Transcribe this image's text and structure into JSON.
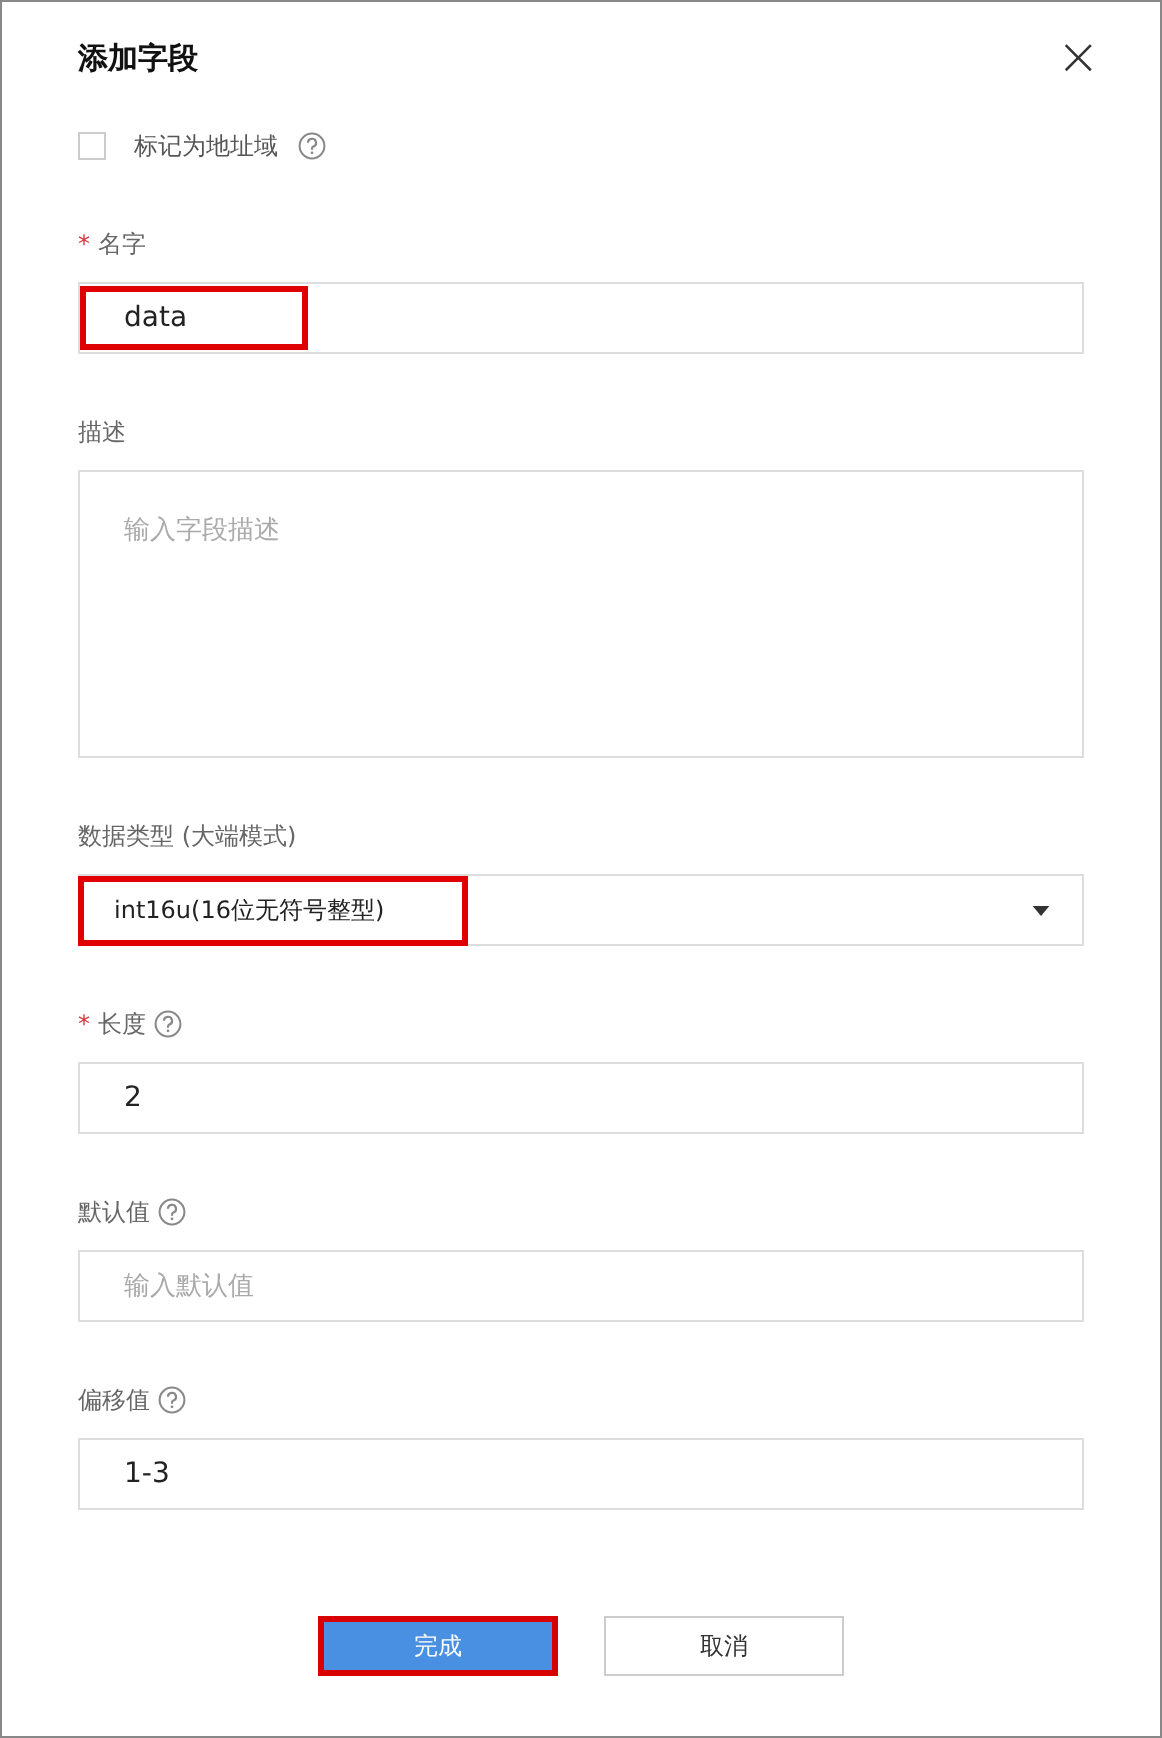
{
  "dialog": {
    "title": "添加字段",
    "close_icon": "×"
  },
  "address_checkbox": {
    "label": "标记为地址域",
    "checked": false,
    "help": true
  },
  "fields": [
    {
      "kind": "text",
      "required_mark": "*",
      "label": "名字",
      "value": "data",
      "highlighted": true
    },
    {
      "kind": "textarea",
      "label": "描述",
      "placeholder": "输入字段描述"
    },
    {
      "kind": "select",
      "label": "数据类型 (大端模式)",
      "value": "int16u(16位无符号整型)",
      "highlighted": true
    },
    {
      "kind": "text",
      "required_mark": "*",
      "label": "长度",
      "help": true,
      "value": "2",
      "highlighted": false
    },
    {
      "kind": "text",
      "label": "默认值",
      "help": true,
      "placeholder": "输入默认值"
    },
    {
      "kind": "text",
      "label": "偏移值",
      "help": true,
      "value": "1-3",
      "highlighted": false
    }
  ],
  "buttons": [
    {
      "label": "完成",
      "primary": true,
      "highlighted": true
    },
    {
      "label": "取消",
      "primary": false,
      "highlighted": false
    }
  ]
}
